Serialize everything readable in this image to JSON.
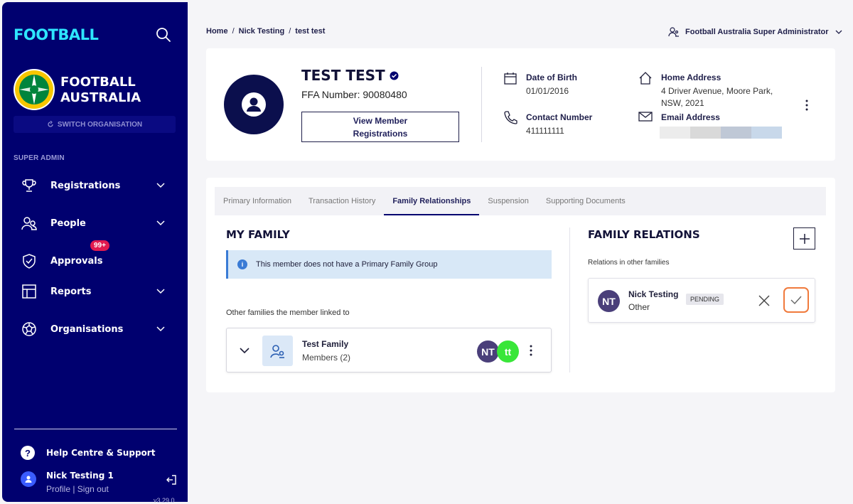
{
  "sidebar": {
    "brand": "FOOTBALL",
    "org_name_line1": "FOOTBALL",
    "org_name_line2": "AUSTRALIA",
    "switch_org": "SWITCH ORGANISATION",
    "section_label": "SUPER ADMIN",
    "items": [
      {
        "label": "Registrations",
        "icon": "trophy-icon"
      },
      {
        "label": "People",
        "icon": "people-icon"
      },
      {
        "label": "Approvals",
        "icon": "shield-check-icon",
        "badge": "99+"
      },
      {
        "label": "Reports",
        "icon": "table-icon"
      },
      {
        "label": "Organisations",
        "icon": "football-icon"
      }
    ],
    "help": "Help Centre & Support",
    "user_name": "Nick Testing 1",
    "user_links": "Profile | Sign out",
    "version": "v3.29.0"
  },
  "breadcrumb": {
    "home": "Home",
    "level2": "Nick Testing",
    "current": "test test",
    "sep": "/"
  },
  "role": "Football Australia Super Administrator",
  "member": {
    "name": "TEST TEST",
    "ffa_number": "FFA Number: 90080480",
    "view_registrations_line1": "View Member",
    "view_registrations_line2": "Registrations",
    "dob_label": "Date of Birth",
    "dob": "01/01/2016",
    "contact_label": "Contact Number",
    "contact": "411111111",
    "address_label": "Home Address",
    "address_line1": "4 Driver Avenue, Moore Park,",
    "address_line2": "NSW, 2021",
    "email_label": "Email Address"
  },
  "tabs": [
    {
      "label": "Primary Information",
      "active": false
    },
    {
      "label": "Transaction History",
      "active": false
    },
    {
      "label": "Family Relationships",
      "active": true
    },
    {
      "label": "Suspension",
      "active": false
    },
    {
      "label": "Supporting Documents",
      "active": false
    }
  ],
  "my_family": {
    "title": "MY FAMILY",
    "alert": "This member does not have a Primary Family Group",
    "linked_label": "Other families the member linked to",
    "family_name": "Test Family",
    "members": "Members (2)",
    "avatars": [
      {
        "initials": "NT",
        "color": "#4a3f7a"
      },
      {
        "initials": "tt",
        "color": "#39e639"
      }
    ]
  },
  "family_relations": {
    "title": "FAMILY RELATIONS",
    "subtitle": "Relations in other families",
    "relation": {
      "initials": "NT",
      "name": "Nick Testing",
      "type": "Other",
      "status": "PENDING"
    }
  },
  "colors": {
    "sidebar": "#00006f",
    "brand": "#2ee6ff",
    "accent_orange": "#f07a3c",
    "badge_red": "#e01a4f"
  }
}
